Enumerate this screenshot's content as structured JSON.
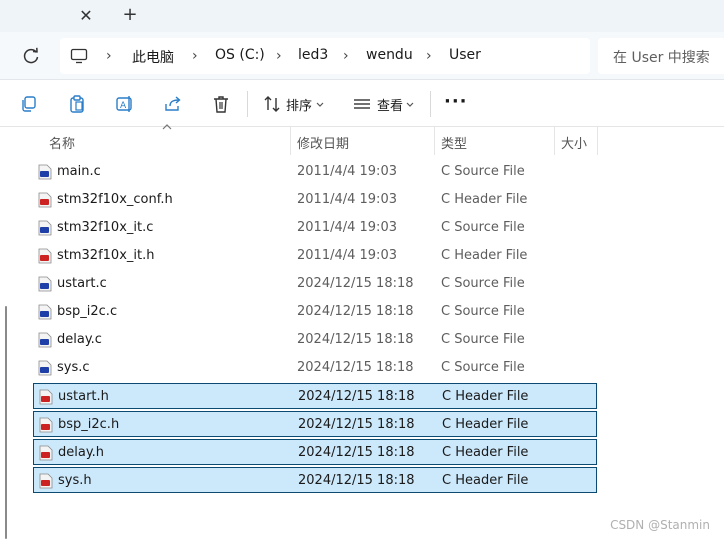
{
  "tabs": {
    "close_label": "✕",
    "new_tab_label": "+"
  },
  "breadcrumb": [
    "此电脑",
    "OS (C:)",
    "led3",
    "wendu",
    "User"
  ],
  "breadcrumb_separator": "›",
  "search": {
    "placeholder": "在 User 中搜索"
  },
  "toolbar": {
    "sort_label": "排序",
    "view_label": "查看",
    "more_label": "···"
  },
  "columns": {
    "name": "名称",
    "modified": "修改日期",
    "type": "类型",
    "size": "大小"
  },
  "files": [
    {
      "name": "main.c",
      "modified": "2011/4/4 19:03",
      "type": "C Source File",
      "kind": "c",
      "selected": false
    },
    {
      "name": "stm32f10x_conf.h",
      "modified": "2011/4/4 19:03",
      "type": "C Header File",
      "kind": "h",
      "selected": false
    },
    {
      "name": "stm32f10x_it.c",
      "modified": "2011/4/4 19:03",
      "type": "C Source File",
      "kind": "c",
      "selected": false
    },
    {
      "name": "stm32f10x_it.h",
      "modified": "2011/4/4 19:03",
      "type": "C Header File",
      "kind": "h",
      "selected": false
    },
    {
      "name": "ustart.c",
      "modified": "2024/12/15 18:18",
      "type": "C Source File",
      "kind": "c",
      "selected": false
    },
    {
      "name": "bsp_i2c.c",
      "modified": "2024/12/15 18:18",
      "type": "C Source File",
      "kind": "c",
      "selected": false
    },
    {
      "name": "delay.c",
      "modified": "2024/12/15 18:18",
      "type": "C Source File",
      "kind": "c",
      "selected": false
    },
    {
      "name": "sys.c",
      "modified": "2024/12/15 18:18",
      "type": "C Source File",
      "kind": "c",
      "selected": false
    },
    {
      "name": "ustart.h",
      "modified": "2024/12/15 18:18",
      "type": "C Header File",
      "kind": "h",
      "selected": true
    },
    {
      "name": "bsp_i2c.h",
      "modified": "2024/12/15 18:18",
      "type": "C Header File",
      "kind": "h",
      "selected": true
    },
    {
      "name": "delay.h",
      "modified": "2024/12/15 18:18",
      "type": "C Header File",
      "kind": "h",
      "selected": true
    },
    {
      "name": "sys.h",
      "modified": "2024/12/15 18:18",
      "type": "C Header File",
      "kind": "h",
      "selected": true
    }
  ],
  "colors": {
    "selection_bg": "#cce8fb",
    "selection_border": "#0d4a72",
    "c_file_badge": "#1f3fa8",
    "h_file_badge": "#cc2222"
  },
  "icons": {
    "c_file": "c-source-file-icon",
    "h_file": "c-header-file-icon"
  },
  "watermark": "CSDN @Stanmin"
}
